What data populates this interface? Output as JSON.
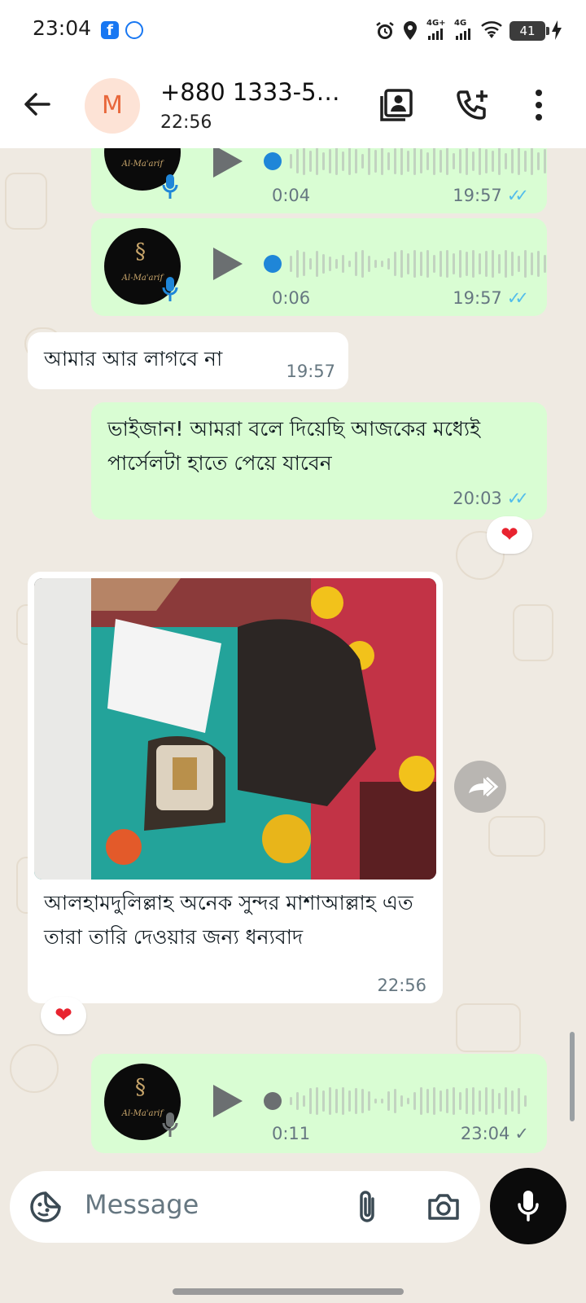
{
  "status_bar": {
    "time": "23:04",
    "network_1": "4G+",
    "network_2": "4G",
    "battery": "41"
  },
  "header": {
    "avatar_letter": "M",
    "title": "+880 1333-5…",
    "subtitle": "22:56"
  },
  "messages": {
    "voice_1": {
      "duration": "0:04",
      "time": "19:57",
      "brand": "Al-Ma'arif"
    },
    "voice_2": {
      "duration": "0:06",
      "time": "19:57",
      "brand": "Al-Ma'arif"
    },
    "incoming_1": {
      "text": "আমার আর লাগবে না",
      "time": "19:57"
    },
    "outgoing_1": {
      "text": "ভাইজান! আমরা বলে দিয়েছি আজকের মধ্যেই পার্সেলটা হাতে পেয়ে যাবেন",
      "time": "20:03",
      "reaction": "❤"
    },
    "incoming_photo": {
      "caption": "আলহামদুলিল্লাহ অনেক সুন্দর মাশাআল্লাহ এত তারা তারি দেওয়ার জন্য ধন্যবাদ",
      "time": "22:56",
      "reaction": "❤"
    },
    "voice_3": {
      "duration": "0:11",
      "time": "23:04",
      "brand": "Al-Ma'arif"
    }
  },
  "input": {
    "placeholder": "Message"
  },
  "colors": {
    "outgoing_bubble": "#d9fdd3",
    "incoming_bubble": "#ffffff",
    "read_tick": "#53bdeb",
    "chat_bg": "#efeae2"
  }
}
